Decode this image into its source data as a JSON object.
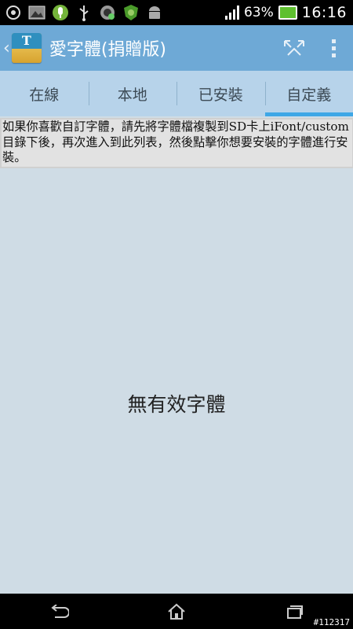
{
  "status_bar": {
    "battery_percent": "63%",
    "time": "16:16",
    "icons": [
      "settings-icon",
      "image-icon",
      "microphone-icon",
      "usb-icon",
      "globe-icon",
      "antivirus-icon",
      "android-icon"
    ]
  },
  "action_bar": {
    "title": "愛字體(捐贈版)",
    "logo_text": "T",
    "share_icon": "share-icon",
    "overflow_icon": "overflow-menu-icon"
  },
  "tabs": [
    {
      "label": "在線",
      "active": false
    },
    {
      "label": "本地",
      "active": false
    },
    {
      "label": "已安裝",
      "active": false
    },
    {
      "label": "自定義",
      "active": true
    }
  ],
  "notice": "如果你喜歡自訂字體，請先將字體檔複製到SD卡上iFont/custom目錄下後，再次進入到此列表，然後點擊你想要安裝的字體進行安裝。",
  "empty_message": "無有效字體",
  "nav_bar": {
    "back_icon": "back-icon",
    "home_icon": "home-icon",
    "recents_icon": "recent-apps-icon"
  },
  "watermark": "#112317",
  "colors": {
    "action_bar": "#6ea9d6",
    "tabs": "#b7d3ea",
    "tab_indicator": "#3ea7e6",
    "background": "#cfdce5"
  }
}
